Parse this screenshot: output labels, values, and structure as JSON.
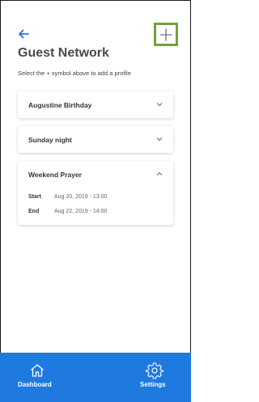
{
  "header": {
    "back_icon": "arrow-left-icon",
    "add_icon": "plus-icon",
    "title": "Guest Network",
    "subtitle": "Select the + symbol above to add a profile"
  },
  "profiles": [
    {
      "name": "Augustine Birthday",
      "expanded": false
    },
    {
      "name": "Sunday night",
      "expanded": false
    },
    {
      "name": "Weekend Prayer",
      "expanded": true,
      "start_label": "Start",
      "start_value": "Aug 20, 2019 - 13:00",
      "end_label": "End",
      "end_value": "Aug 22, 2019 - 14:00"
    }
  ],
  "tabbar": {
    "items": [
      {
        "label": "Dashboard",
        "icon": "home-icon"
      },
      {
        "label": "Settings",
        "icon": "gear-icon"
      }
    ]
  },
  "colors": {
    "accent": "#1f7ae0",
    "highlight": "#6fa33a"
  }
}
